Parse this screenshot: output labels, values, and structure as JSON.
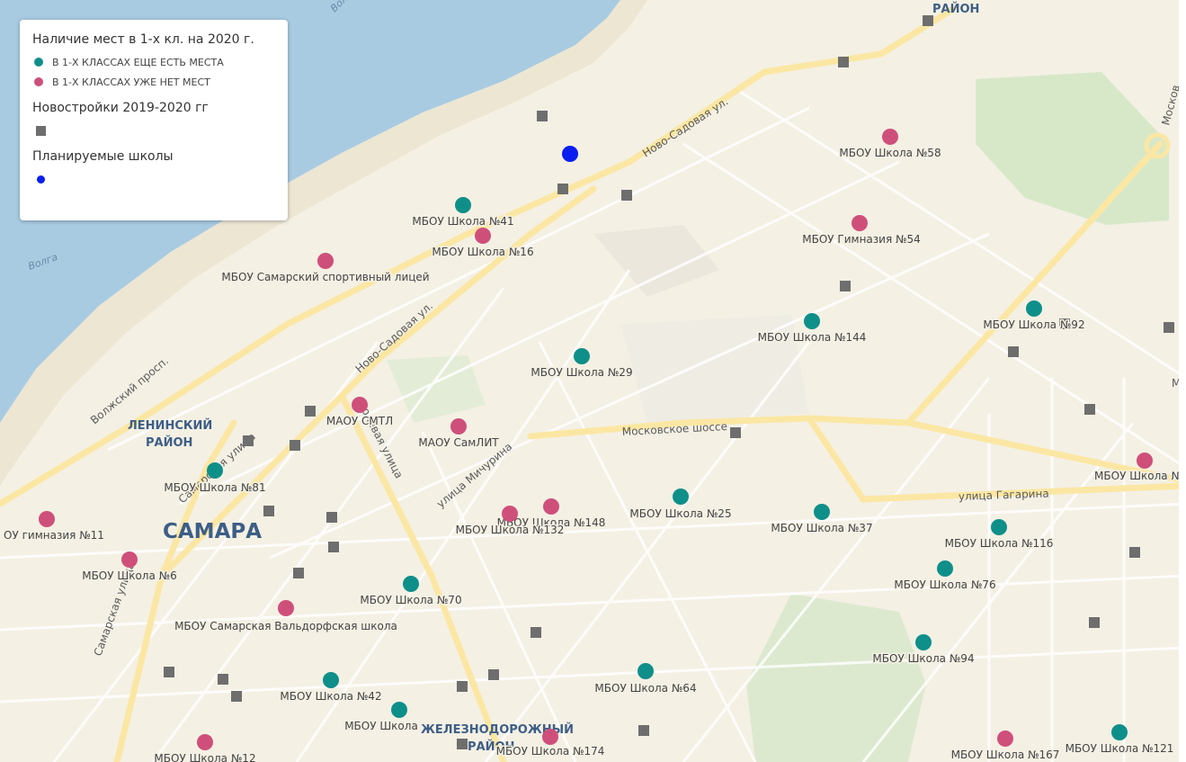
{
  "legend": {
    "title": "Наличие мест в 1-х кл. на 2020 г.",
    "items": [
      {
        "label": "В 1-Х КЛАССАХ ЕЩЕ ЕСТЬ МЕСТА",
        "color": "#0f8f8a"
      },
      {
        "label": "В 1-Х КЛАССАХ УЖЕ НЕТ МЕСТ",
        "color": "#cf4f7b"
      }
    ],
    "new_buildings_title": "Новостройки 2019-2020 гг",
    "planned_title": "Планируемые школы",
    "square_color": "#6e6e6e",
    "planned_color": "#0a1ef0"
  },
  "map": {
    "city_label": "САМАРА",
    "districts": [
      {
        "text": "РАЙОН"
      },
      {
        "text": "ЛЕНИНСКИЙ"
      },
      {
        "text": "РАЙОН"
      },
      {
        "text": "ЖЕЛЕЗНОДОРОЖНЫЙ"
      },
      {
        "text": "РАЙОН"
      }
    ],
    "streets": [
      {
        "text": "Ново-Садовая ул."
      },
      {
        "text": "Ново-Садовая ул."
      },
      {
        "text": "Волжский просп."
      },
      {
        "text": "Самарская улица"
      },
      {
        "text": "Полевая улица"
      },
      {
        "text": "улица Мичурина"
      },
      {
        "text": "Московское шоссе"
      },
      {
        "text": "улица Гагарина"
      },
      {
        "text": "Самарская улица"
      },
      {
        "text": "Волга"
      },
      {
        "text": "Волга"
      },
      {
        "text": "Москов"
      },
      {
        "text": "М"
      }
    ],
    "schools": [
      {
        "name": "МБОУ Школа №58",
        "status": "full"
      },
      {
        "name": "МБОУ Гимназия №54",
        "status": "full"
      },
      {
        "name": "МБОУ Школа №41",
        "status": "open"
      },
      {
        "name": "МБОУ Школа №16",
        "status": "full"
      },
      {
        "name": "МБОУ Самарский спортивный лицей",
        "status": "full"
      },
      {
        "name": "МБОУ Школа №144",
        "status": "open"
      },
      {
        "name": "МБОУ Школа №92",
        "status": "open"
      },
      {
        "name": "МБОУ Школа №29",
        "status": "open"
      },
      {
        "name": "МАОУ СМТЛ",
        "status": "full"
      },
      {
        "name": "МАОУ СамЛИТ",
        "status": "full"
      },
      {
        "name": "МБОУ Школа №81",
        "status": "open"
      },
      {
        "name": "МБОУ Школа №148",
        "status": "full"
      },
      {
        "name": "МБОУ Школа №132",
        "status": "full"
      },
      {
        "name": "МБОУ Школа №25",
        "status": "open"
      },
      {
        "name": "МБОУ Школа №37",
        "status": "open"
      },
      {
        "name": "МБОУ Школа №116",
        "status": "open"
      },
      {
        "name": "МБОУ Школа №",
        "status": "full"
      },
      {
        "name": "ОУ гимназия №11",
        "status": "full"
      },
      {
        "name": "МБОУ Школа №6",
        "status": "full"
      },
      {
        "name": "МБОУ Школа №70",
        "status": "open"
      },
      {
        "name": "МБОУ Школа №76",
        "status": "open"
      },
      {
        "name": "МБОУ Самарская Вальдорфская школа",
        "status": "full"
      },
      {
        "name": "МБОУ Школа №94",
        "status": "open"
      },
      {
        "name": "МБОУ Школа №42",
        "status": "open"
      },
      {
        "name": "МБОУ Школа №64",
        "status": "open"
      },
      {
        "name": "МБОУ Школа",
        "status": "open"
      },
      {
        "name": "МБОУ Школа №174",
        "status": "full"
      },
      {
        "name": "МБОУ Школа №12",
        "status": "full"
      },
      {
        "name": "МБОУ Школа №167",
        "status": "full"
      },
      {
        "name": "МБОУ Школа №121",
        "status": "open"
      }
    ],
    "new_building_count": 34,
    "planned_school_count": 1
  }
}
